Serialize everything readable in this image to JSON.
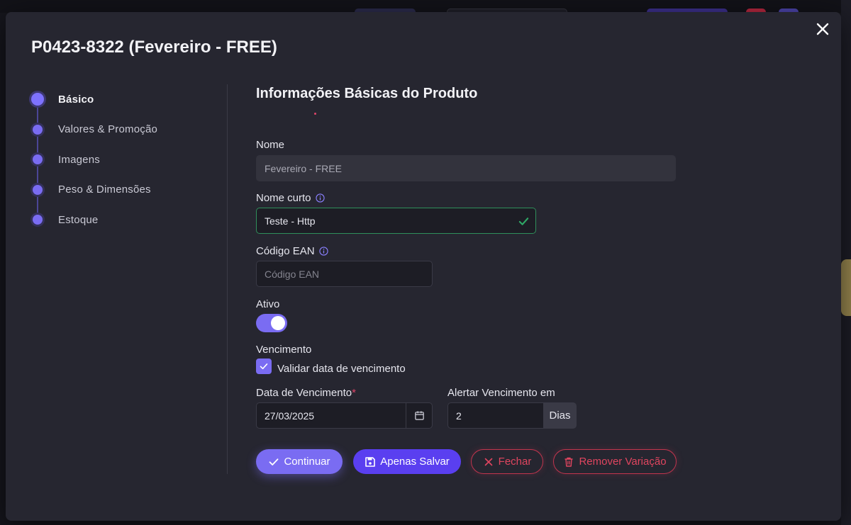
{
  "modal": {
    "title": "P0423-8322 (Fevereiro - FREE)"
  },
  "stepper": {
    "steps": [
      {
        "label": "Básico",
        "active": true
      },
      {
        "label": "Valores & Promoção",
        "active": false
      },
      {
        "label": "Imagens",
        "active": false
      },
      {
        "label": "Peso & Dimensões",
        "active": false
      },
      {
        "label": "Estoque",
        "active": false
      }
    ]
  },
  "form": {
    "section_title": "Informações Básicas do Produto",
    "nome": {
      "label": "Nome",
      "value": "Fevereiro - FREE"
    },
    "nome_curto": {
      "label": "Nome curto",
      "value": "Teste - Http"
    },
    "ean": {
      "label": "Código EAN",
      "placeholder": "Código EAN"
    },
    "ativo": {
      "label": "Ativo",
      "on": true
    },
    "vencimento": {
      "label": "Vencimento",
      "checkbox_label": "Validar data de vencimento",
      "checked": true
    },
    "data_vencimento": {
      "label": "Data de Vencimento",
      "required_mark": "*",
      "value": "27/03/2025"
    },
    "alertar": {
      "label": "Alertar Vencimento em",
      "value": "2",
      "addon": "Dias"
    }
  },
  "buttons": {
    "continue": "Continuar",
    "save": "Apenas Salvar",
    "close": "Fechar",
    "remove": "Remover Variação"
  },
  "colors": {
    "accent": "#7a6cf2",
    "primary": "#5a3ff0",
    "danger": "#e0455f",
    "success": "#2f8f5b",
    "modal_bg": "#262630"
  }
}
